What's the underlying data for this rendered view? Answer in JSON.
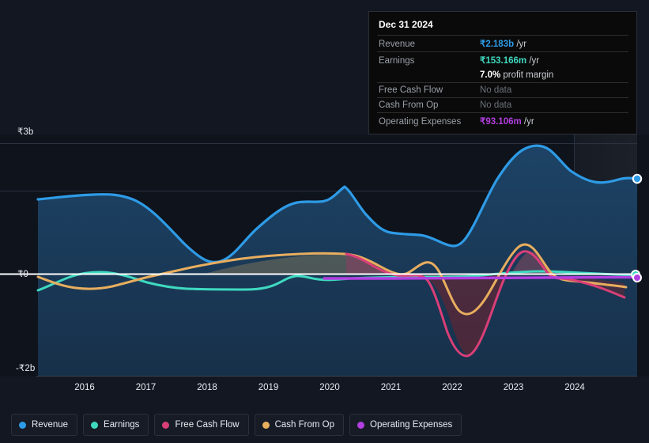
{
  "chart_data": {
    "type": "area",
    "title": "",
    "xlabel": "",
    "ylabel": "",
    "currency_symbol": "₹",
    "x_tick_labels": [
      "2016",
      "2017",
      "2018",
      "2019",
      "2020",
      "2021",
      "2022",
      "2023",
      "2024"
    ],
    "y_tick_labels": [
      "₹3b",
      "₹0",
      "-₹2b"
    ],
    "ylim": [
      -2000000000,
      3000000000
    ],
    "xlim": [
      "2015-06",
      "2025-03"
    ],
    "grid": true,
    "legend_position": "bottom",
    "forecast_region_start": "2024",
    "series": [
      {
        "name": "Revenue",
        "color": "#2e9be6",
        "fill": "#1b3a55",
        "units": "₹",
        "x": [
          "2015.6",
          "2016.0",
          "2016.5",
          "2017.0",
          "2017.5",
          "2018.0",
          "2018.5",
          "2019.0",
          "2019.5",
          "2020.0",
          "2020.25",
          "2020.5",
          "2021.0",
          "2021.4",
          "2021.75",
          "2022.0",
          "2022.5",
          "2023.0",
          "2023.3",
          "2023.7",
          "2024.0",
          "2024.4",
          "2024.75",
          "2025.1"
        ],
        "values": [
          1.62,
          1.68,
          1.68,
          1.6,
          1.28,
          0.88,
          0.66,
          0.72,
          1.05,
          1.52,
          1.3,
          1.12,
          1.1,
          1.02,
          0.9,
          1.3,
          2.18,
          2.64,
          2.62,
          2.3,
          2.08,
          2.0,
          2.13,
          2.183
        ]
      },
      {
        "name": "Earnings",
        "color": "#3fd9c0",
        "units": "₹",
        "x": [
          "2015.6",
          "2016.0",
          "2016.5",
          "2017.0",
          "2017.5",
          "2018.0",
          "2018.5",
          "2019.0",
          "2019.5",
          "2020.0",
          "2020.5",
          "2021.0",
          "2021.5",
          "2022.0",
          "2022.5",
          "2023.0",
          "2023.5",
          "2024.0",
          "2024.5",
          "2025.1"
        ],
        "values": [
          -0.17,
          0.01,
          0.03,
          0.02,
          -0.02,
          -0.06,
          -0.07,
          -0.07,
          -0.06,
          -0.03,
          -0.02,
          -0.01,
          0.01,
          0.02,
          0.03,
          0.05,
          0.08,
          0.1,
          0.13,
          0.153166
        ]
      },
      {
        "name": "Free Cash Flow",
        "color": "#d93f77",
        "units": "₹",
        "x": [
          "2020.25",
          "2020.5",
          "2021.0",
          "2021.4",
          "2021.7",
          "2022.0",
          "2022.3",
          "2022.6",
          "2023.0",
          "2023.3",
          "2023.6",
          "2024.0",
          "2024.5",
          "2024.9"
        ],
        "values": [
          0.26,
          0.2,
          0.02,
          0.04,
          -0.1,
          -1.12,
          -1.15,
          -0.55,
          0.38,
          0.42,
          0.05,
          -0.02,
          -0.18,
          -0.28
        ]
      },
      {
        "name": "Cash From Op",
        "color": "#e8ae5e",
        "units": "₹",
        "x": [
          "2015.6",
          "2016.0",
          "2016.5",
          "2017.0",
          "2017.5",
          "2018.0",
          "2018.5",
          "2019.0",
          "2019.5",
          "2020.0",
          "2020.4",
          "2020.8",
          "2021.2",
          "2021.5",
          "2021.8",
          "2022.1",
          "2022.4",
          "2022.8",
          "2023.1",
          "2023.4",
          "2023.8",
          "2024.1",
          "2024.5",
          "2024.9"
        ],
        "values": [
          -0.03,
          -0.17,
          -0.21,
          -0.18,
          -0.1,
          0.0,
          0.1,
          0.18,
          0.24,
          0.28,
          0.26,
          0.18,
          0.06,
          0.11,
          0.02,
          -0.58,
          -0.6,
          -0.2,
          0.48,
          0.42,
          0.05,
          -0.01,
          -0.06,
          -0.1
        ]
      },
      {
        "name": "Operating Expenses",
        "color": "#b23fe0",
        "units": "₹",
        "x": [
          "2020.3",
          "2021.0",
          "2022.0",
          "2023.0",
          "2024.0",
          "2025.1"
        ],
        "values": [
          0.06,
          0.06,
          0.06,
          0.07,
          0.08,
          0.093106
        ]
      }
    ]
  },
  "tooltip": {
    "date": "Dec 31 2024",
    "rows": [
      {
        "label": "Revenue",
        "value": "₹2.183b",
        "suffix": " /yr",
        "color": "#2e9be6",
        "has_data": true
      },
      {
        "label": "Earnings",
        "value": "₹153.166m",
        "suffix": " /yr",
        "color": "#3fd9c0",
        "has_data": true
      },
      {
        "label": "",
        "value": "7.0%",
        "suffix": " profit margin",
        "color": "#ffffff",
        "has_data": true
      },
      {
        "label": "Free Cash Flow",
        "value": "No data",
        "suffix": "",
        "color": "#6b7078",
        "has_data": false
      },
      {
        "label": "Cash From Op",
        "value": "No data",
        "suffix": "",
        "color": "#6b7078",
        "has_data": false
      },
      {
        "label": "Operating Expenses",
        "value": "₹93.106m",
        "suffix": " /yr",
        "color": "#b23fe0",
        "has_data": true
      }
    ]
  },
  "legend": {
    "items": [
      {
        "label": "Revenue",
        "color": "#2e9be6"
      },
      {
        "label": "Earnings",
        "color": "#3fd9c0"
      },
      {
        "label": "Free Cash Flow",
        "color": "#d93f77"
      },
      {
        "label": "Cash From Op",
        "color": "#e8ae5e"
      },
      {
        "label": "Operating Expenses",
        "color": "#b23fe0"
      }
    ]
  },
  "axes": {
    "y_top": "₹3b",
    "y_zero": "₹0",
    "y_bottom": "-₹2b"
  },
  "colors": {
    "background": "#121722",
    "plot_background": "#0e131c",
    "grid": "#2b3240",
    "zero_line": "#ffffff",
    "text": "#e8ecf2",
    "muted_text": "#9aa0a8"
  }
}
